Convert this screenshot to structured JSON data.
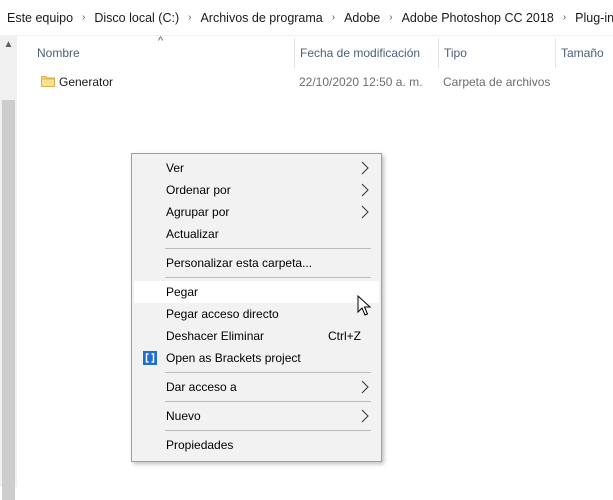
{
  "breadcrumb": {
    "items": [
      "Este equipo",
      "Disco local (C:)",
      "Archivos de programa",
      "Adobe",
      "Adobe Photoshop CC 2018",
      "Plug-ins"
    ],
    "separator": "›"
  },
  "columns": {
    "name": "Nombre",
    "modified": "Fecha de modificación",
    "type": "Tipo",
    "size": "Tamaño"
  },
  "files": [
    {
      "name": "Generator",
      "modified": "22/10/2020 12:50 a. m.",
      "type": "Carpeta de archivos",
      "icon": "folder-icon"
    }
  ],
  "context_menu": {
    "items": [
      {
        "label": "Ver",
        "submenu": true
      },
      {
        "label": "Ordenar por",
        "submenu": true
      },
      {
        "label": "Agrupar por",
        "submenu": true
      },
      {
        "label": "Actualizar"
      },
      {
        "label": "Personalizar esta carpeta..."
      },
      {
        "label": "Pegar",
        "hovered": true
      },
      {
        "label": "Pegar acceso directo"
      },
      {
        "label": "Deshacer Eliminar",
        "shortcut": "Ctrl+Z"
      },
      {
        "label": "Open as Brackets project",
        "icon": "brackets-icon"
      },
      {
        "label": "Dar acceso a",
        "submenu": true
      },
      {
        "label": "Nuevo",
        "submenu": true
      },
      {
        "label": "Propiedades"
      }
    ]
  },
  "colors": {
    "header_text": "#4c607a",
    "type_text": "#6d6d6d",
    "menu_bg": "#f2f2f2",
    "folder": "#f8d775",
    "brackets": "#1f6fd1"
  }
}
